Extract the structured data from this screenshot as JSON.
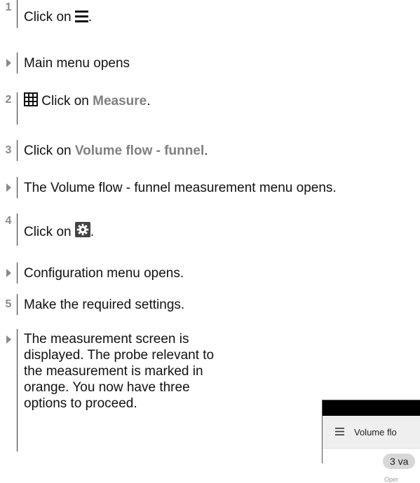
{
  "steps": [
    {
      "marker": "1",
      "text_before": "Click on ",
      "icon": "menu-icon",
      "text_after": "."
    },
    {
      "marker": "arrow",
      "text": "Main menu opens"
    },
    {
      "marker": "2",
      "icon": "grid-icon",
      "text_before": " Click on ",
      "highlight": "Measure",
      "text_after": "."
    },
    {
      "marker": "3",
      "text_before": "Click on ",
      "highlight": "Volume flow - funnel",
      "text_after": "."
    },
    {
      "marker": "arrow",
      "text": "The Volume flow - funnel measurement menu opens."
    },
    {
      "marker": "4",
      "text_before": "Click on ",
      "icon": "gear-icon",
      "text_after": "."
    },
    {
      "marker": "arrow",
      "text": "Configuration menu opens."
    },
    {
      "marker": "5",
      "text": "Make the required settings."
    },
    {
      "marker": "arrow",
      "text": "The measurement screen is displayed. The probe relevant to the measurement is marked in orange. You now have three options to proceed."
    }
  ],
  "device_preview": {
    "title": "Volume flo",
    "pill": "3 va",
    "tiny_text": "Oper"
  },
  "colors": {
    "highlight": "#808080",
    "marker": "#8a8a8a",
    "device_header": "#efefef"
  }
}
